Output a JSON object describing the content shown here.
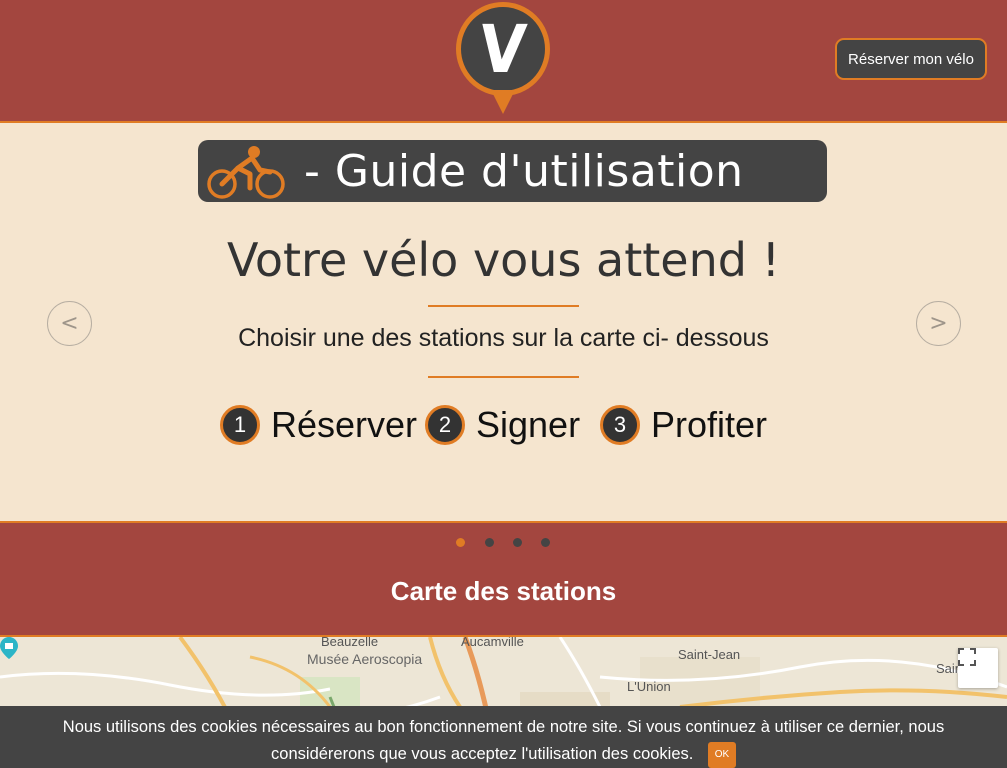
{
  "header": {
    "logo_letter": "V",
    "reserve_label": "Réserver mon vélo"
  },
  "carousel": {
    "guide_title": "- Guide d'utilisation",
    "slide_title": "Votre vélo vous attend !",
    "slide_subtitle": "Choisir une des stations sur la carte ci- dessous",
    "steps": [
      {
        "num": "1",
        "label": "Réserver"
      },
      {
        "num": "2",
        "label": "Signer"
      },
      {
        "num": "3",
        "label": "Profiter"
      }
    ],
    "prev_label": "<",
    "next_label": ">",
    "slide_count": 4,
    "active_slide": 1
  },
  "stations": {
    "title": "Carte des stations"
  },
  "map": {
    "labels": {
      "beauzelle": "Beauzelle",
      "musee": "Musée Aeroscopia",
      "aucamville": "Aucamville",
      "saint_jean": "Saint-Jean",
      "lunion": "L'Union",
      "saint_partial": "Sain"
    },
    "fullscreen_icon": "fullscreen-icon"
  },
  "cookie": {
    "line1": "Nous utilisons des cookies nécessaires au bon fonctionnement de notre site. Si vous continuez à utiliser ce dernier, nous",
    "line2": "considérerons que vous acceptez l'utilisation des cookies.",
    "ok_label": "OK"
  },
  "colors": {
    "brand_red": "#a3463f",
    "accent_orange": "#e07c24",
    "dark": "#444444",
    "cream": "#f5e5cf"
  }
}
